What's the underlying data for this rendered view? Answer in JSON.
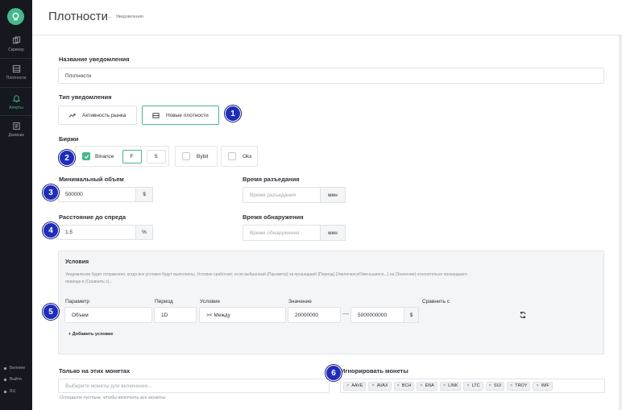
{
  "sidebar": {
    "items": [
      {
        "label": "Скринер",
        "icon": "screener-icon"
      },
      {
        "label": "Плотности",
        "icon": "density-icon"
      },
      {
        "label": "Алерты",
        "icon": "bell-icon",
        "active": true
      },
      {
        "label": "Дневник",
        "icon": "journal-icon"
      }
    ],
    "bottom": [
      {
        "label": "Биллинг",
        "icon": "billing-icon"
      },
      {
        "label": "Выйти",
        "icon": "logout-icon"
      },
      {
        "label": "RU",
        "icon": "language-icon"
      }
    ]
  },
  "header": {
    "title": "Плотности",
    "breadcrumb": "Уведомления"
  },
  "form": {
    "name_label": "Название уведомления",
    "name_value": "Плотности",
    "type_label": "Тип уведомления",
    "types": [
      {
        "label": "Активность рынка",
        "icon": "trend-icon",
        "selected": false
      },
      {
        "label": "Новые плотности",
        "icon": "orderbook-icon",
        "selected": true
      }
    ],
    "exchanges_label": "Биржи",
    "exchanges": [
      {
        "name": "Binance",
        "checked": true,
        "segments": [
          {
            "label": "F",
            "active": true
          },
          {
            "label": "S",
            "active": false
          }
        ]
      },
      {
        "name": "Bybit",
        "checked": false
      },
      {
        "name": "Okx",
        "checked": false
      }
    ],
    "min_volume": {
      "label": "Минимальный объем",
      "value": "500000",
      "unit": "$"
    },
    "corrosion_time": {
      "label": "Время разъедания",
      "placeholder": "Время разъедания",
      "unit": "мин"
    },
    "spread_distance": {
      "label": "Расстояние до спреда",
      "value": "1.5",
      "unit": "%"
    },
    "detection_time": {
      "label": "Время обнаружения",
      "placeholder": "Время обнаружения",
      "unit": "мин"
    },
    "conditions": {
      "title": "Условия",
      "description_line1": "Уведомление будет отправлено, когда все условия будут выполнены. Условие сработает, если выбранный {Параметр} за прошедший {Период} {Увеличился/Уменьшился...} на {Значение} относительно прошедшего",
      "description_line2": "периода в {Сравнить с}...",
      "columns": {
        "param": "Параметр",
        "period": "Период",
        "condition": "Условие",
        "value": "Значение",
        "compare": "Сравнить с"
      },
      "row": {
        "param": "Объем",
        "period": "1D",
        "condition": ">< Между",
        "value_from": "20000000",
        "value_to": "5000000000",
        "unit": "$",
        "dash": "—"
      },
      "add_label": "+ Добавить условие"
    },
    "only_coins": {
      "label": "Только на этих монетах",
      "placeholder": "Выберите монеты для включения...",
      "hint": "Оставьте пустым, чтобы включить все монеты"
    },
    "ignore_coins": {
      "label": "Игнорировать монеты",
      "tags": [
        "AAVE",
        "AVAX",
        "BCH",
        "ENA",
        "LINK",
        "LTC",
        "SUI",
        "TROY",
        "WIF"
      ]
    }
  },
  "annotations": [
    "1",
    "2",
    "3",
    "4",
    "5",
    "6"
  ],
  "colors": {
    "accent": "#47b88a",
    "sidebar_bg": "#15191f",
    "badge": "#1f2dba"
  }
}
